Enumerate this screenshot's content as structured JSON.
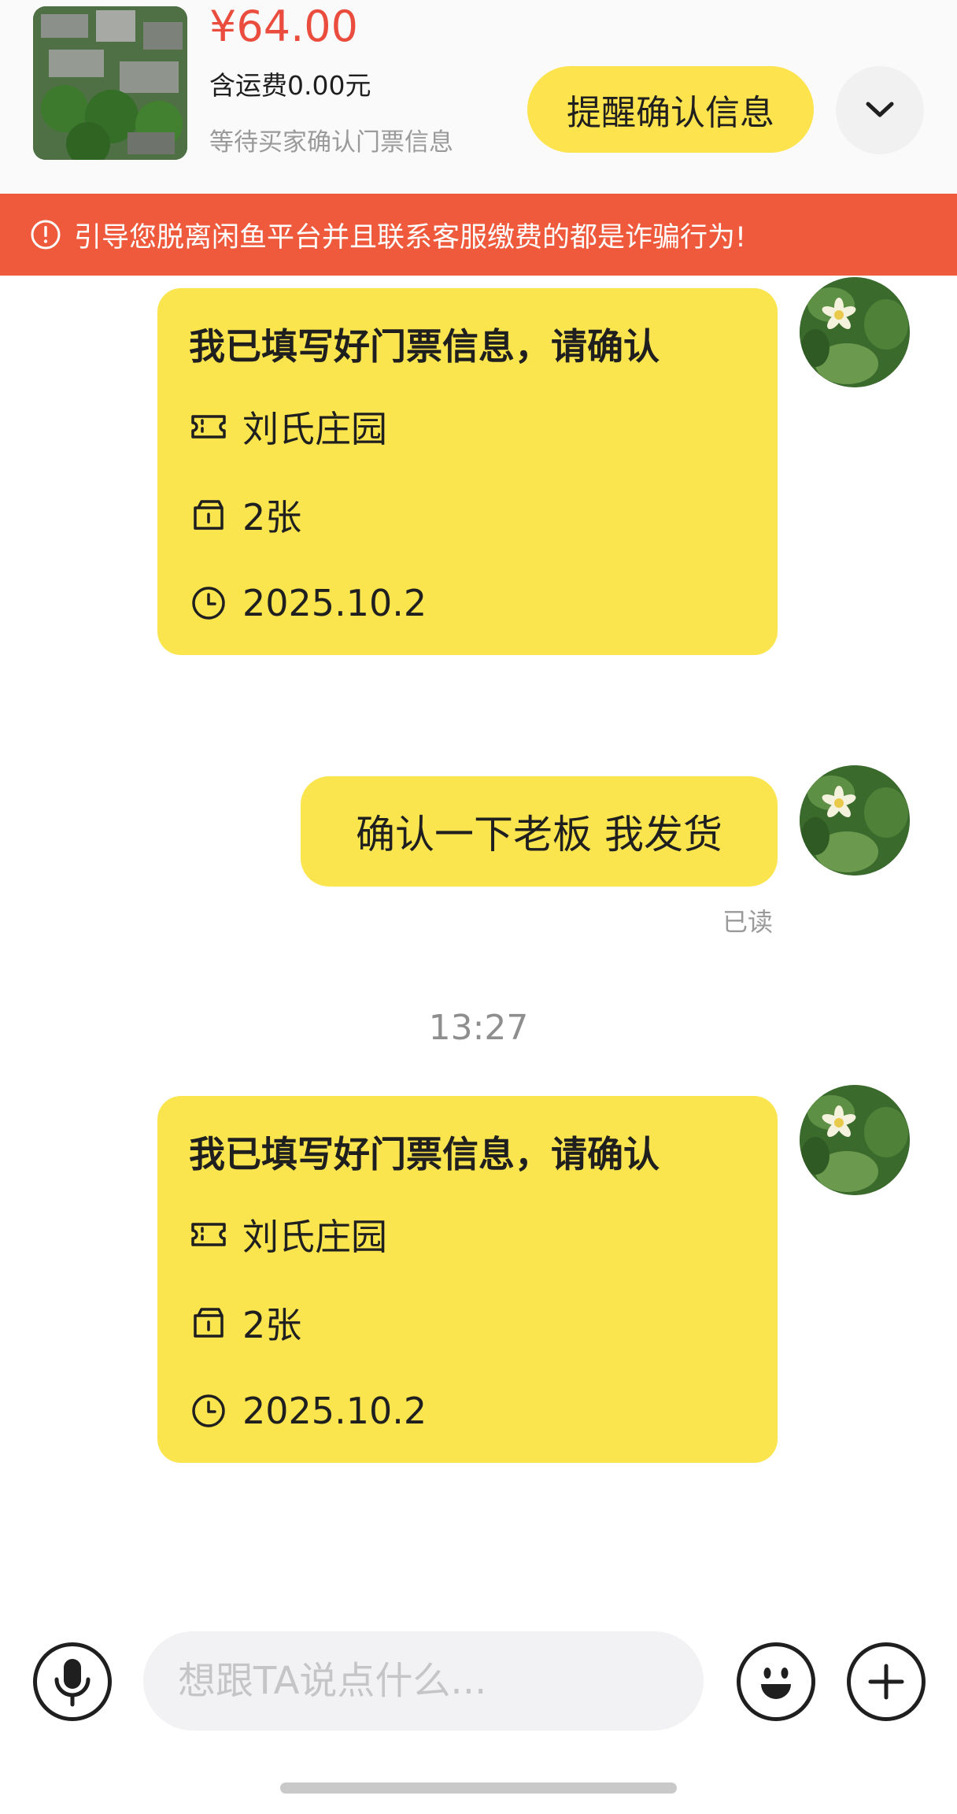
{
  "product": {
    "price": "¥64.00",
    "shipping": "含运费0.00元",
    "status": "等待买家确认门票信息",
    "remind_button": "提醒确认信息",
    "collapse_icon": "chevron-down-icon"
  },
  "warning": {
    "icon": "alert-circle-icon",
    "text": "引导您脱离闲鱼平台并且联系客服缴费的都是诈骗行为!"
  },
  "messages": [
    {
      "type": "ticket-card",
      "title": "我已填写好门票信息，请确认",
      "venue": "刘氏庄园",
      "quantity": "2张",
      "date": "2025.10.2"
    },
    {
      "type": "text",
      "text": "确认一下老板 我发货",
      "receipt": "已读"
    },
    {
      "type": "timestamp",
      "text": "13:27"
    },
    {
      "type": "ticket-card",
      "title": "我已填写好门票信息，请确认",
      "venue": "刘氏庄园",
      "quantity": "2张",
      "date": "2025.10.2"
    }
  ],
  "input_bar": {
    "placeholder": "想跟TA说点什么...",
    "voice_icon": "microphone-icon",
    "emoji_icon": "smiley-icon",
    "more_icon": "plus-icon"
  },
  "colors": {
    "accent_yellow": "#fbe54f",
    "price_red": "#ea4d3d",
    "warning_orange": "#ef5a3c"
  }
}
